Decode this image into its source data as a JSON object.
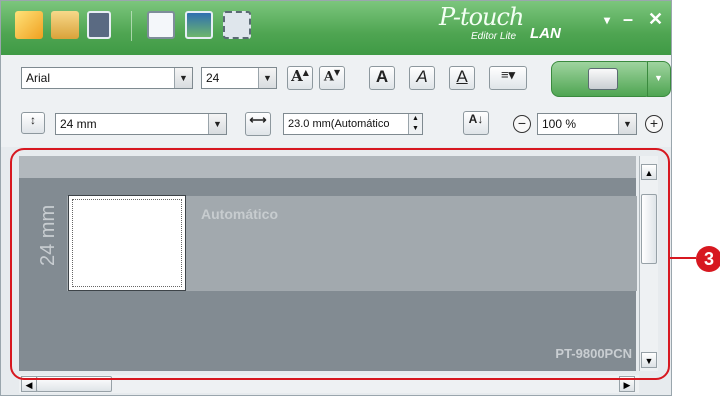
{
  "titlebar": {
    "logo_script": "P-touch",
    "logo_sub": "Editor Lite",
    "logo_lan": "LAN",
    "dropdown": "▾",
    "minimize": "–",
    "close": "✕"
  },
  "toolbar": {
    "font_family": "Arial",
    "font_size": "24",
    "grow_font_label": "A",
    "shrink_font_label": "A",
    "bold_label": "A",
    "italic_label": "A",
    "underline_label": "A",
    "tape_width": "24 mm",
    "tape_length": "23.0 mm(Automático",
    "zoom": "100 %",
    "zoom_out": "−",
    "zoom_in": "+"
  },
  "canvas": {
    "tape_size_label": "24 mm",
    "auto_label": "Automático",
    "model_label": "PT-9800PCN"
  },
  "callout": {
    "number": "3"
  },
  "colors": {
    "titlebar": "#4fa552",
    "highlight": "#d71820",
    "canvas_bg": "#828b92"
  }
}
